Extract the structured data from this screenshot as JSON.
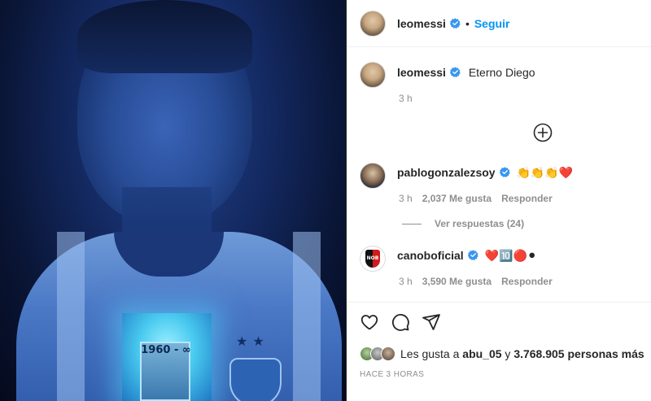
{
  "header": {
    "username": "leomessi",
    "separator": "•",
    "follow_label": "Seguir"
  },
  "photo": {
    "jersey_text": "1960 - ∞"
  },
  "caption": {
    "username": "leomessi",
    "text": "Eterno Diego",
    "time": "3 h"
  },
  "comments": [
    {
      "username": "pablogonzalezsoy",
      "text": "👏👏👏❤️",
      "time": "3 h",
      "likes": "2,037 Me gusta",
      "reply_label": "Responder",
      "view_replies": "Ver respuestas (24)"
    },
    {
      "username": "canoboficial",
      "text": "❤️🔟🔴⚫",
      "time": "3 h",
      "likes": "3,590 Me gusta",
      "reply_label": "Responder",
      "avatar_badge": "NOB"
    }
  ],
  "likes_bar": {
    "prefix": "Les gusta a",
    "user": "abu_05",
    "connector": "y",
    "others": "3.768.905 personas más"
  },
  "posted": "HACE 3 HORAS",
  "colors": {
    "follow": "#0095f6",
    "verified": "#3897f0",
    "meta": "#8e8e8e"
  },
  "icons": [
    "verified-badge-icon",
    "add-comment-icon",
    "heart-icon",
    "comment-icon",
    "share-icon"
  ]
}
